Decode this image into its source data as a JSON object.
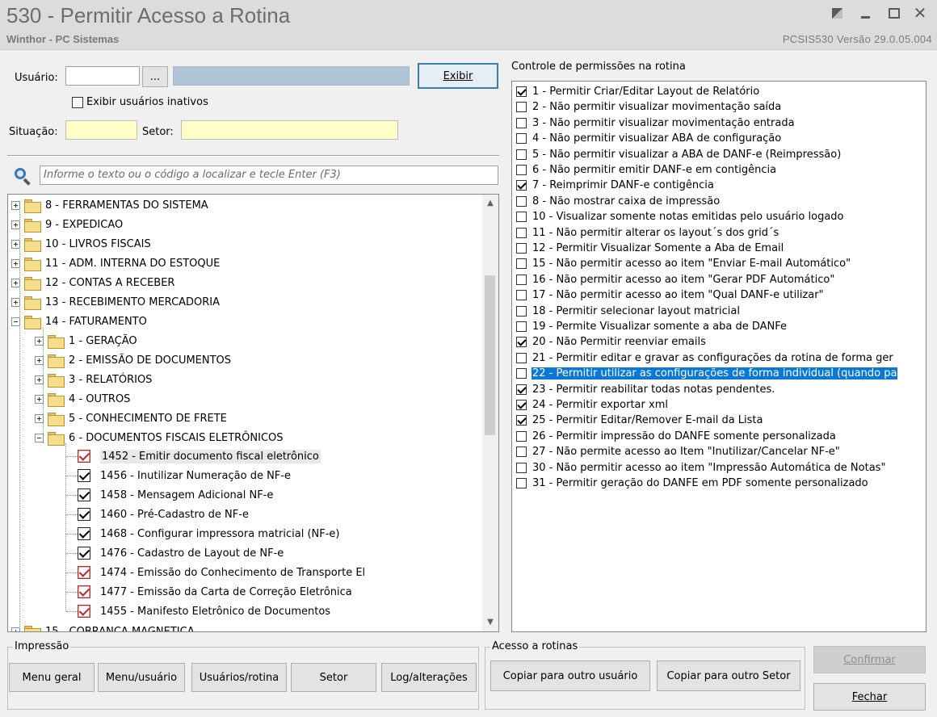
{
  "window": {
    "title": "530 - Permitir Acesso a Rotina",
    "subtitle": "Winthor - PC Sistemas",
    "version": "PCSIS530  Versão  29.0.05.004",
    "controls": [
      "tile-icon",
      "minimize-icon",
      "maximize-icon",
      "close-icon"
    ]
  },
  "user": {
    "label": "Usuário:",
    "code": "",
    "lookup_button": "...",
    "name": "",
    "show_button": "Exibir",
    "inactive_label": "Exibir usuários inativos",
    "situacao_label": "Situação:",
    "situacao_value": "",
    "setor_label": "Setor:",
    "setor_value": ""
  },
  "search": {
    "placeholder": "Informe o texto ou o código a localizar e tecle Enter (F3)"
  },
  "tree": {
    "root_nodes": [
      "8 - FERRAMENTAS DO SISTEMA",
      "9 - EXPEDICAO",
      "10 - LIVROS FISCAIS",
      "11 - ADM. INTERNA DO ESTOQUE",
      "12 - CONTAS A RECEBER",
      "13 - RECEBIMENTO MERCADORIA",
      "14 - FATURAMENTO"
    ],
    "sub_nodes": [
      "1 - GERAÇÃO",
      "2 - EMISSÃO DE DOCUMENTOS",
      "3 - RELATÓRIOS",
      "4 - OUTROS",
      "5 - CONHECIMENTO DE FRETE",
      "6 - DOCUMENTOS FISCAIS ELETRÔNICOS"
    ],
    "leaf_items": [
      {
        "label": "1452 - Emitir documento fiscal eletrônico",
        "style": "red"
      },
      {
        "label": "1456 - Inutilizar Numeração de NF-e",
        "style": "black"
      },
      {
        "label": "1458 - Mensagem Adicional NF-e",
        "style": "black"
      },
      {
        "label": "1460 - Pré-Cadastro de NF-e",
        "style": "black"
      },
      {
        "label": "1468 - Configurar impressora matricial (NF-e)",
        "style": "black"
      },
      {
        "label": "1476 - Cadastro de Layout de NF-e",
        "style": "black"
      },
      {
        "label": "1474 - Emissão do Conhecimento de Transporte El",
        "style": "red"
      },
      {
        "label": "1477 - Emissão da Carta de Correção Eletrônica",
        "style": "red"
      },
      {
        "label": "1455 - Manifesto Eletrônico de Documentos",
        "style": "red"
      }
    ],
    "last_partial": "15 - COBRANCA MAGNETICA"
  },
  "permissions": {
    "title": "Controle de permissões na rotina",
    "items": [
      {
        "label": "1 - Permitir Criar/Editar Layout de Relatório",
        "checked": true
      },
      {
        "label": "2 - Não permitir visualizar movimentação saída",
        "checked": false
      },
      {
        "label": "3 - Não permitir visualizar movimentação entrada",
        "checked": false
      },
      {
        "label": "4 - Não permitir visualizar ABA de configuração",
        "checked": false
      },
      {
        "label": "5 - Não permitir visualizar a ABA de DANF-e (Reimpressão)",
        "checked": false
      },
      {
        "label": "6 - Não permitir emitir DANF-e em contigência",
        "checked": false
      },
      {
        "label": "7 - Reimprimir DANF-e contigência",
        "checked": true
      },
      {
        "label": "8 - Não mostrar caixa de impressão",
        "checked": false
      },
      {
        "label": "10 - Visualizar somente notas emitidas pelo usuário logado",
        "checked": false
      },
      {
        "label": "11 - Não permitir alterar os layout´s dos grid´s",
        "checked": false
      },
      {
        "label": "12 - Permitir Visualizar Somente a Aba de Email",
        "checked": false
      },
      {
        "label": "15 - Não permitir acesso ao item \"Enviar E-mail Automático\"",
        "checked": false
      },
      {
        "label": "16 - Não permitir acesso ao item \"Gerar PDF Automático\"",
        "checked": false
      },
      {
        "label": "17 - Não permitir acesso ao item \"Qual DANF-e utilizar\"",
        "checked": false
      },
      {
        "label": "18 - Permitir selecionar layout matricial",
        "checked": false
      },
      {
        "label": "19 - Permite Visualizar somente a aba de DANFe",
        "checked": false
      },
      {
        "label": "20 - Não Permitir reenviar emails",
        "checked": true
      },
      {
        "label": "21 - Permitir editar e gravar as configurações da rotina de forma ger",
        "checked": false
      },
      {
        "label": "22 - Permitir utilizar as configurações de forma individual (quando pa",
        "checked": false,
        "selected": true
      },
      {
        "label": "23 - Permitir reabilitar todas notas pendentes.",
        "checked": true
      },
      {
        "label": "24 - Permitir exportar xml",
        "checked": true
      },
      {
        "label": "25 - Permitir Editar/Remover E-mail da Lista",
        "checked": true
      },
      {
        "label": "26 - Permitir impressão do DANFE somente personalizada",
        "checked": false
      },
      {
        "label": "27 - Não permite acesso ao Item \"Inutilizar/Cancelar NF-e\"",
        "checked": false
      },
      {
        "label": "30 - Não permitir acesso ao item \"Impressão Automática de Notas\"",
        "checked": false
      },
      {
        "label": "31 - Permitir geração do DANFE em PDF somente personalizado",
        "checked": false
      }
    ]
  },
  "impressao": {
    "title": "Impressão",
    "buttons": [
      "Menu geral",
      "Menu/usuário",
      "Usuários/rotina",
      "Setor",
      "Log/alterações"
    ]
  },
  "acesso": {
    "title": "Acesso a rotinas",
    "buttons": [
      "Copiar para outro usuário",
      "Copiar para outro Setor"
    ]
  },
  "actions": {
    "confirm": "Confirmar",
    "close": "Fechar"
  }
}
